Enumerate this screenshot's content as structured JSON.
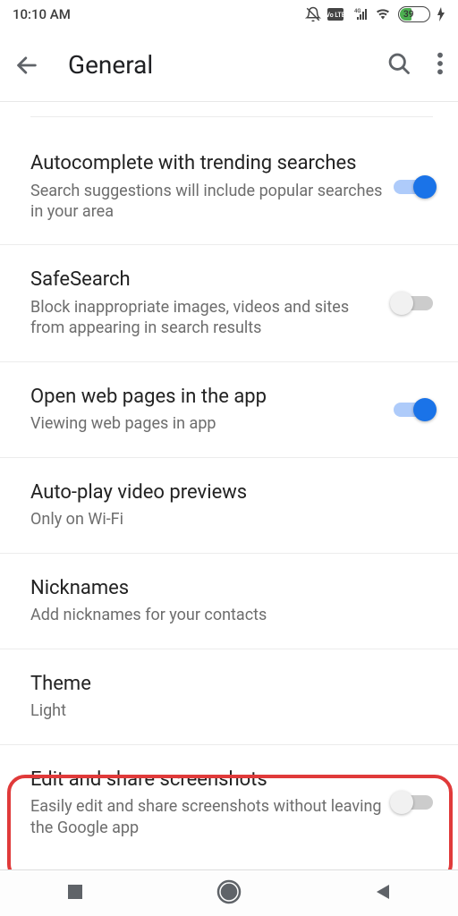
{
  "status": {
    "time": "10:10 AM",
    "battery_percent": "39"
  },
  "header": {
    "title": "General"
  },
  "settings": [
    {
      "title": "Autocomplete with trending searches",
      "subtitle": "Search suggestions will include popular searches in your area",
      "toggle": "on"
    },
    {
      "title": "SafeSearch",
      "subtitle": "Block inappropriate images, videos and sites from appearing in search results",
      "toggle": "off"
    },
    {
      "title": "Open web pages in the app",
      "subtitle": "Viewing web pages in app",
      "toggle": "on"
    },
    {
      "title": "Auto-play video previews",
      "subtitle": "Only on Wi-Fi",
      "toggle": null
    },
    {
      "title": "Nicknames",
      "subtitle": "Add nicknames for your contacts",
      "toggle": null
    },
    {
      "title": "Theme",
      "subtitle": "Light",
      "toggle": null
    },
    {
      "title": "Edit and share screenshots",
      "subtitle": "Easily edit and share screenshots without leaving the Google app",
      "toggle": "off"
    }
  ]
}
